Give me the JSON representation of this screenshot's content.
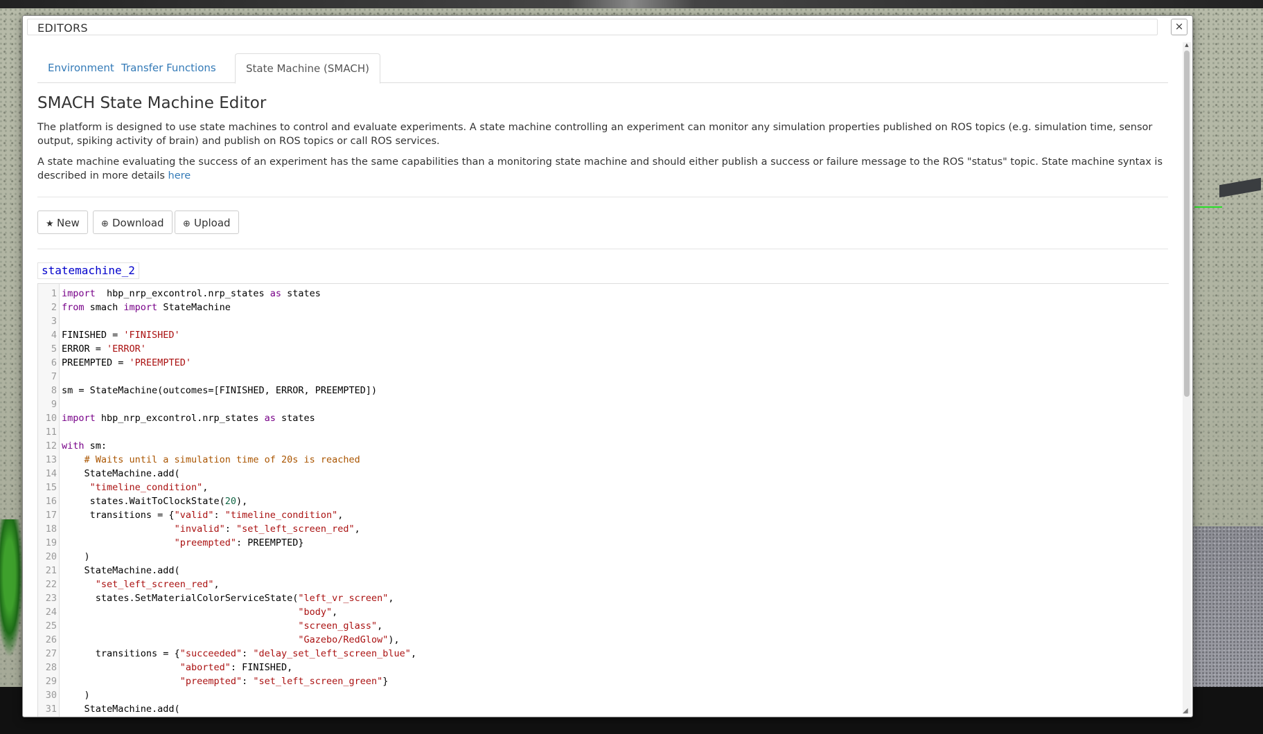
{
  "modal": {
    "title": "EDITORS",
    "close_label": "×"
  },
  "tabs": [
    {
      "label": "Environment",
      "active": false
    },
    {
      "label": "Transfer Functions",
      "active": false
    },
    {
      "label": "State Machine (SMACH)",
      "active": true
    }
  ],
  "page": {
    "title": "SMACH State Machine Editor",
    "para1": "The platform is designed to use state machines to control and evaluate experiments. A state machine controlling an experiment can monitor any simulation properties published on ROS topics (e.g. simulation time, sensor output, spiking activity of brain) and publish on ROS topics or call ROS services.",
    "para2": "A state machine evaluating the success of an experiment has the same capabilities than a monitoring state machine and should either publish a success or failure message to the ROS \"status\" topic. State machine syntax is described in more details",
    "para2_link": "here"
  },
  "toolbar": {
    "new_icon": "star-icon",
    "new_label": "New",
    "download_icon": "download-icon",
    "download_label": "Download",
    "upload_icon": "upload-icon",
    "upload_label": "Upload"
  },
  "statemachine_name": "statemachine_2",
  "code_lines": [
    {
      "n": "1",
      "segs": [
        [
          "kw",
          "import"
        ],
        [
          "",
          "  hbp_nrp_excontrol.nrp_states "
        ],
        [
          "kw",
          "as"
        ],
        [
          "",
          " states"
        ]
      ]
    },
    {
      "n": "2",
      "segs": [
        [
          "kw",
          "from"
        ],
        [
          "",
          " smach "
        ],
        [
          "kw",
          "import"
        ],
        [
          "",
          " StateMachine"
        ]
      ]
    },
    {
      "n": "3",
      "segs": []
    },
    {
      "n": "4",
      "segs": [
        [
          "",
          "FINISHED = "
        ],
        [
          "str",
          "'FINISHED'"
        ]
      ]
    },
    {
      "n": "5",
      "segs": [
        [
          "",
          "ERROR = "
        ],
        [
          "str",
          "'ERROR'"
        ]
      ]
    },
    {
      "n": "6",
      "segs": [
        [
          "",
          "PREEMPTED = "
        ],
        [
          "str",
          "'PREEMPTED'"
        ]
      ]
    },
    {
      "n": "7",
      "segs": []
    },
    {
      "n": "8",
      "segs": [
        [
          "",
          "sm = StateMachine(outcomes=[FINISHED, ERROR, PREEMPTED])"
        ]
      ]
    },
    {
      "n": "9",
      "segs": []
    },
    {
      "n": "10",
      "segs": [
        [
          "kw",
          "import"
        ],
        [
          "",
          " hbp_nrp_excontrol.nrp_states "
        ],
        [
          "kw",
          "as"
        ],
        [
          "",
          " states"
        ]
      ]
    },
    {
      "n": "11",
      "segs": []
    },
    {
      "n": "12",
      "segs": [
        [
          "kw",
          "with"
        ],
        [
          "",
          " sm:"
        ]
      ]
    },
    {
      "n": "13",
      "segs": [
        [
          "",
          "    "
        ],
        [
          "cmt",
          "# Waits until a simulation time of 20s is reached"
        ]
      ]
    },
    {
      "n": "14",
      "segs": [
        [
          "",
          "    StateMachine.add("
        ]
      ]
    },
    {
      "n": "15",
      "segs": [
        [
          "",
          "     "
        ],
        [
          "str",
          "\"timeline_condition\""
        ],
        [
          "",
          ","
        ]
      ]
    },
    {
      "n": "16",
      "segs": [
        [
          "",
          "     states.WaitToClockState("
        ],
        [
          "num",
          "20"
        ],
        [
          "",
          "),"
        ]
      ]
    },
    {
      "n": "17",
      "segs": [
        [
          "",
          "     transitions = {"
        ],
        [
          "str",
          "\"valid\""
        ],
        [
          "",
          ": "
        ],
        [
          "str",
          "\"timeline_condition\""
        ],
        [
          "",
          ","
        ]
      ]
    },
    {
      "n": "18",
      "segs": [
        [
          "",
          "                    "
        ],
        [
          "str",
          "\"invalid\""
        ],
        [
          "",
          ": "
        ],
        [
          "str",
          "\"set_left_screen_red\""
        ],
        [
          "",
          ","
        ]
      ]
    },
    {
      "n": "19",
      "segs": [
        [
          "",
          "                    "
        ],
        [
          "str",
          "\"preempted\""
        ],
        [
          "",
          ": PREEMPTED}"
        ]
      ]
    },
    {
      "n": "20",
      "segs": [
        [
          "",
          "    )"
        ]
      ]
    },
    {
      "n": "21",
      "segs": [
        [
          "",
          "    StateMachine.add("
        ]
      ]
    },
    {
      "n": "22",
      "segs": [
        [
          "",
          "      "
        ],
        [
          "str",
          "\"set_left_screen_red\""
        ],
        [
          "",
          ","
        ]
      ]
    },
    {
      "n": "23",
      "segs": [
        [
          "",
          "      states.SetMaterialColorServiceState("
        ],
        [
          "str",
          "\"left_vr_screen\""
        ],
        [
          "",
          ","
        ]
      ]
    },
    {
      "n": "24",
      "segs": [
        [
          "",
          "                                          "
        ],
        [
          "str",
          "\"body\""
        ],
        [
          "",
          ","
        ]
      ]
    },
    {
      "n": "25",
      "segs": [
        [
          "",
          "                                          "
        ],
        [
          "str",
          "\"screen_glass\""
        ],
        [
          "",
          ","
        ]
      ]
    },
    {
      "n": "26",
      "segs": [
        [
          "",
          "                                          "
        ],
        [
          "str",
          "\"Gazebo/RedGlow\""
        ],
        [
          "",
          "),"
        ]
      ]
    },
    {
      "n": "27",
      "segs": [
        [
          "",
          "      transitions = {"
        ],
        [
          "str",
          "\"succeeded\""
        ],
        [
          "",
          ": "
        ],
        [
          "str",
          "\"delay_set_left_screen_blue\""
        ],
        [
          "",
          ","
        ]
      ]
    },
    {
      "n": "28",
      "segs": [
        [
          "",
          "                     "
        ],
        [
          "str",
          "\"aborted\""
        ],
        [
          "",
          ": FINISHED,"
        ]
      ]
    },
    {
      "n": "29",
      "segs": [
        [
          "",
          "                     "
        ],
        [
          "str",
          "\"preempted\""
        ],
        [
          "",
          ": "
        ],
        [
          "str",
          "\"set_left_screen_green\""
        ],
        [
          "",
          "}"
        ]
      ]
    },
    {
      "n": "30",
      "segs": [
        [
          "",
          "    )"
        ]
      ]
    },
    {
      "n": "31",
      "segs": [
        [
          "",
          "    StateMachine.add("
        ]
      ]
    }
  ]
}
